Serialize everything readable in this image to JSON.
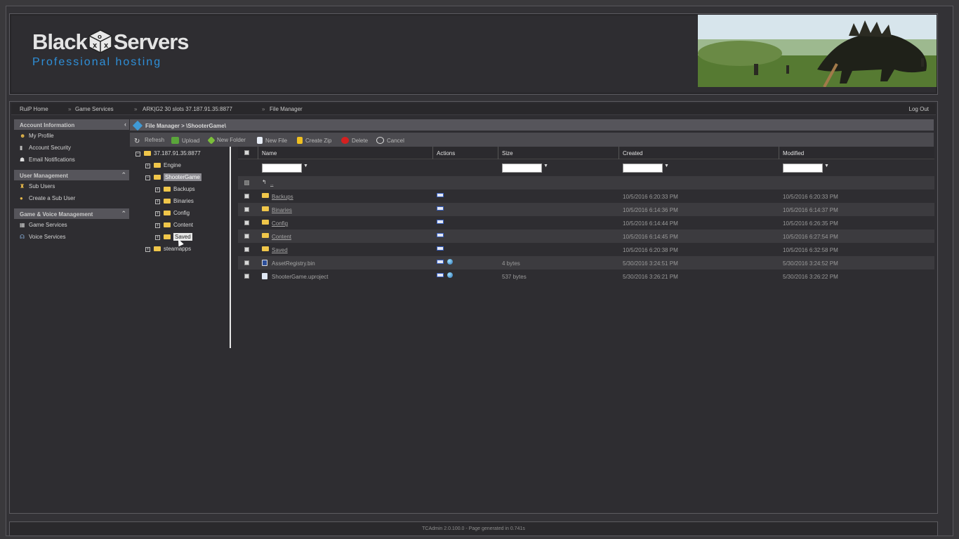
{
  "header": {
    "logo_left": "Black",
    "logo_right": "Servers",
    "logo_tagline": "Professional hosting",
    "banner_alt": "banner-image"
  },
  "breadcrumb": {
    "items": [
      "RuiP Home",
      "Game Services",
      "ARK|G2 30 slots 37.187.91.35:8877",
      "File Manager"
    ],
    "separator": "»"
  },
  "topbar": {
    "logout": "Log Out"
  },
  "sidebar": {
    "sections": [
      {
        "title": "Account Information",
        "arrow": "‹",
        "items": [
          {
            "label": "My Profile",
            "icon": "profile-icon"
          },
          {
            "label": "Account Security",
            "icon": "security-icon"
          },
          {
            "label": "Email Notifications",
            "icon": "email-icon"
          }
        ]
      },
      {
        "title": "User Management",
        "arrow": "⌃",
        "items": [
          {
            "label": "Sub Users",
            "icon": "sub-users-icon"
          },
          {
            "label": "Create a Sub User",
            "icon": "create-sub-user-icon"
          }
        ]
      },
      {
        "title": "Game & Voice Management",
        "arrow": "⌃",
        "items": [
          {
            "label": "Game Services",
            "icon": "game-services-icon"
          },
          {
            "label": "Voice Services",
            "icon": "voice-services-icon"
          }
        ]
      }
    ]
  },
  "filemanager": {
    "title": "File Manager > \\ShooterGame\\",
    "toolbar": {
      "refresh": "Refresh",
      "upload": "Upload",
      "new_folder": "New Folder",
      "new_file": "New File",
      "create_zip": "Create Zip",
      "delete": "Delete",
      "cancel": "Cancel"
    },
    "tree": {
      "root": "37.187.91.35:8877",
      "engine": "Engine",
      "shootergame": "ShooterGame",
      "backups": "Backups",
      "binaries": "Binaries",
      "config": "Config",
      "content": "Content",
      "saved": "Saved",
      "steamapps": "steamapps"
    },
    "columns": {
      "name": "Name",
      "actions": "Actions",
      "size": "Size",
      "created": "Created",
      "modified": "Modified"
    },
    "parent_row": "..",
    "rows": [
      {
        "name": "Backups",
        "type": "folder",
        "size": "",
        "created": "10/5/2016 6:20:33 PM",
        "modified": "10/5/2016 6:20:33 PM"
      },
      {
        "name": "Binaries",
        "type": "folder",
        "size": "",
        "created": "10/5/2016 6:14:36 PM",
        "modified": "10/5/2016 6:14:37 PM"
      },
      {
        "name": "Config",
        "type": "folder",
        "size": "",
        "created": "10/5/2016 6:14:44 PM",
        "modified": "10/5/2016 6:26:35 PM"
      },
      {
        "name": "Content",
        "type": "folder",
        "size": "",
        "created": "10/5/2016 6:14:45 PM",
        "modified": "10/5/2016 6:27:54 PM"
      },
      {
        "name": "Saved",
        "type": "folder",
        "size": "",
        "created": "10/5/2016 6:20:38 PM",
        "modified": "10/5/2016 6:32:58 PM"
      },
      {
        "name": "AssetRegistry.bin",
        "type": "bin",
        "size": "4 bytes",
        "created": "5/30/2016 3:24:51 PM",
        "modified": "5/30/2016 3:24:52 PM"
      },
      {
        "name": "ShooterGame.uproject",
        "type": "file",
        "size": "537 bytes",
        "created": "5/30/2016 3:26:21 PM",
        "modified": "5/30/2016 3:26:22 PM"
      }
    ]
  },
  "footer": {
    "text": "TCAdmin 2.0.100.0 - Page generated in 0.741s"
  }
}
